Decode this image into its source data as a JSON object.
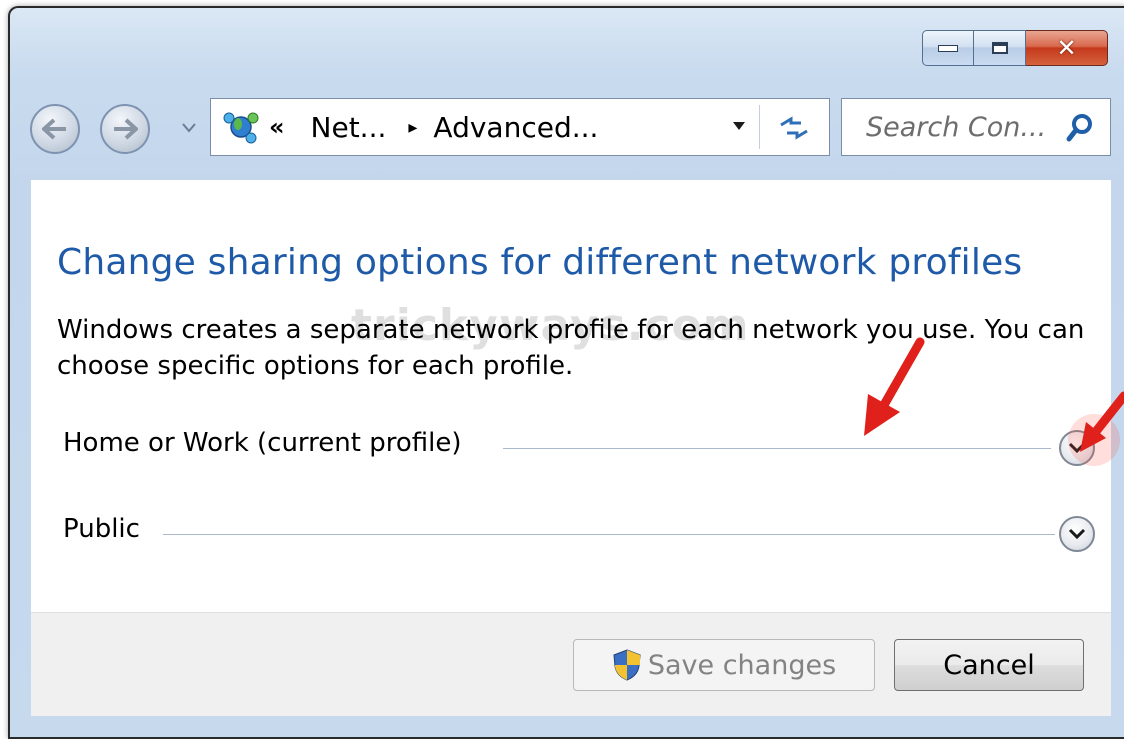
{
  "window": {
    "caption_buttons": [
      "minimize",
      "maximize",
      "close"
    ]
  },
  "nav": {
    "address": {
      "chevron": "«",
      "segment_1": "Net...",
      "separator": "▸",
      "segment_2": "Advanced..."
    },
    "search": {
      "placeholder": "Search Con..."
    }
  },
  "main": {
    "title": "Change sharing options for different network profiles",
    "description": "Windows creates a separate network profile for each network you use. You can choose specific options for each profile.",
    "watermark": "trickyways.com",
    "profiles": [
      {
        "label": "Home or Work (current profile)"
      },
      {
        "label": "Public"
      }
    ]
  },
  "footer": {
    "save_label": "Save changes",
    "cancel_label": "Cancel"
  },
  "colors": {
    "title": "#1e5aa8",
    "annotation_arrow": "#e0201a",
    "close_button": "#c5391c"
  },
  "icons": [
    "minimize-icon",
    "maximize-icon",
    "close-icon",
    "back-arrow-icon",
    "forward-arrow-icon",
    "network-icon",
    "refresh-icon",
    "search-icon",
    "chevron-down-icon",
    "shield-icon"
  ]
}
